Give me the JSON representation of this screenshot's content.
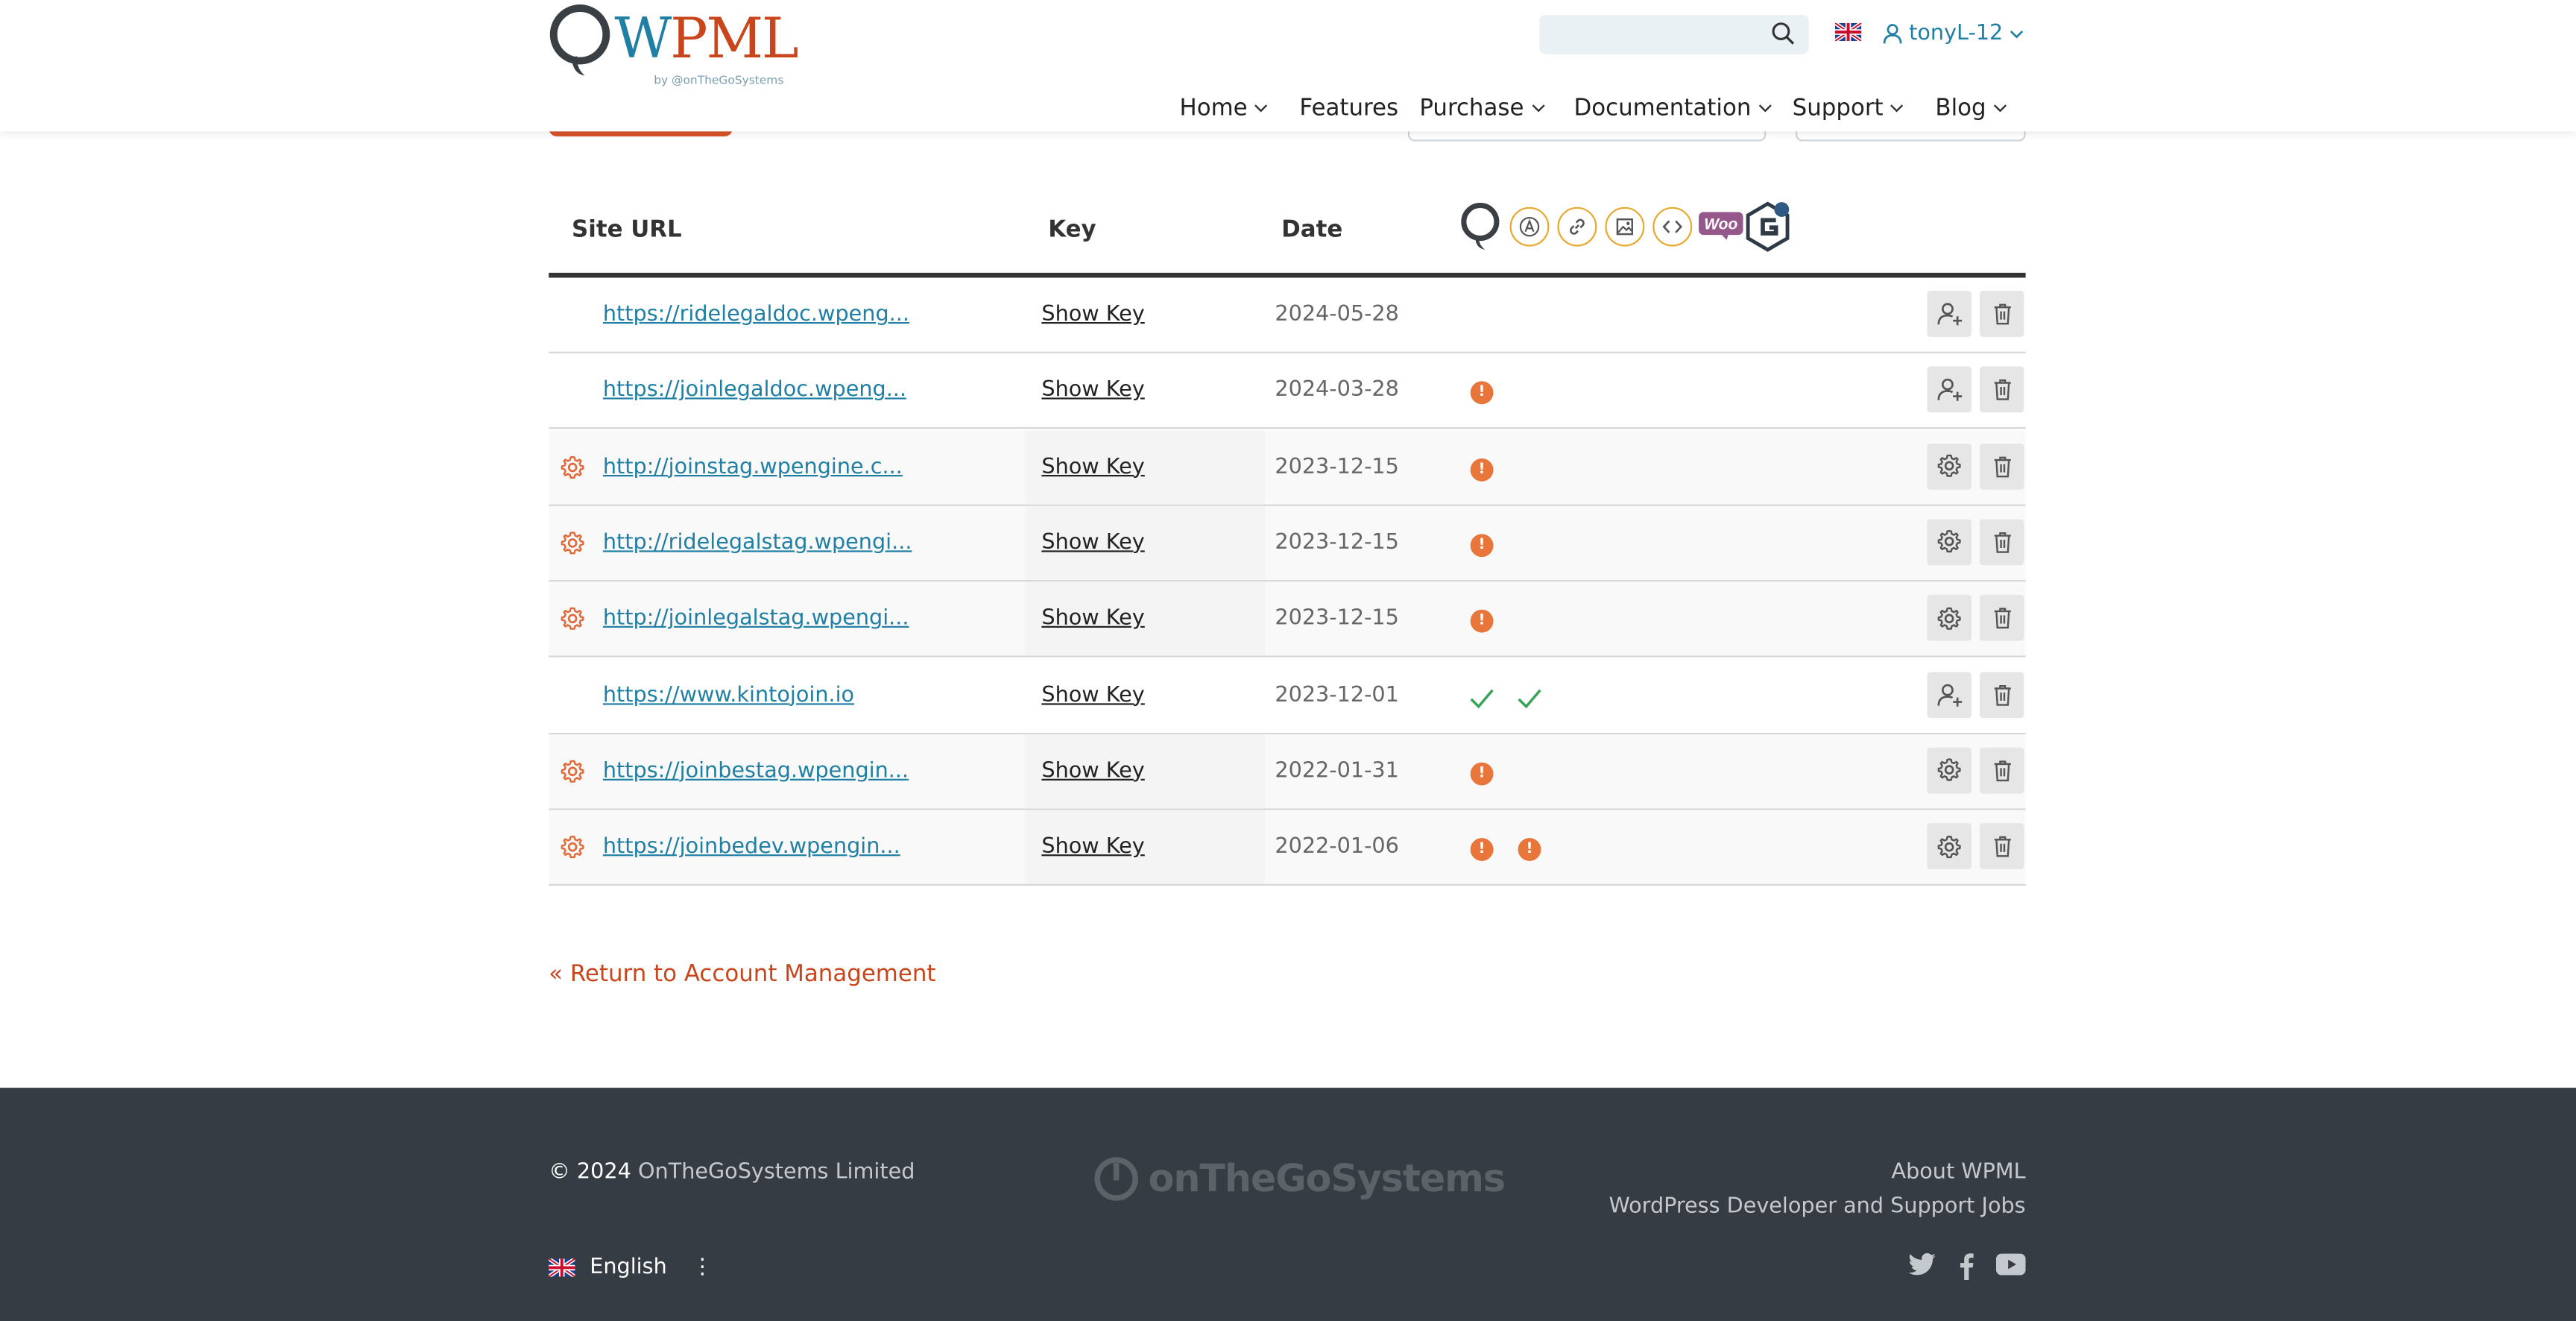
{
  "header": {
    "logo_text_w": "W",
    "logo_text_pml": "PML",
    "logo_by": "by @onTheGoSystems",
    "search_placeholder": "",
    "username": "tonyL-12"
  },
  "nav": [
    {
      "label": "Home",
      "dropdown": true
    },
    {
      "label": "Features",
      "dropdown": false
    },
    {
      "label": "Purchase",
      "dropdown": true
    },
    {
      "label": "Documentation",
      "dropdown": true
    },
    {
      "label": "Support",
      "dropdown": true
    },
    {
      "label": "Blog",
      "dropdown": true
    }
  ],
  "table": {
    "headers": {
      "site_url": "Site URL",
      "key": "Key",
      "date": "Date"
    },
    "plugin_icons": [
      "wpml-logo-icon",
      "string-translation-icon",
      "link-icon",
      "media-icon",
      "code-icon",
      "woocommerce-icon",
      "gravity-forms-icon"
    ],
    "woo_label": "Woo",
    "rows": [
      {
        "url": "https://ridelegaldoc.wpeng...",
        "key_label": "Show Key",
        "date": "2024-05-28",
        "gear": false,
        "status": [],
        "action": "add-user"
      },
      {
        "url": "https://joinlegaldoc.wpeng...",
        "key_label": "Show Key",
        "date": "2024-03-28",
        "gear": false,
        "status": [
          "warn"
        ],
        "action": "add-user"
      },
      {
        "url": "http://joinstag.wpengine.c...",
        "key_label": "Show Key",
        "date": "2023-12-15",
        "gear": true,
        "status": [
          "warn"
        ],
        "action": "settings"
      },
      {
        "url": "http://ridelegalstag.wpengi...",
        "key_label": "Show Key",
        "date": "2023-12-15",
        "gear": true,
        "status": [
          "warn"
        ],
        "action": "settings"
      },
      {
        "url": "http://joinlegalstag.wpengi...",
        "key_label": "Show Key",
        "date": "2023-12-15",
        "gear": true,
        "status": [
          "warn"
        ],
        "action": "settings"
      },
      {
        "url": "https://www.kintojoin.io",
        "key_label": "Show Key",
        "date": "2023-12-01",
        "gear": false,
        "status": [
          "check",
          "check"
        ],
        "action": "add-user"
      },
      {
        "url": "https://joinbestag.wpengin...",
        "key_label": "Show Key",
        "date": "2022-01-31",
        "gear": true,
        "status": [
          "warn"
        ],
        "action": "settings"
      },
      {
        "url": "https://joinbedev.wpengin...",
        "key_label": "Show Key",
        "date": "2022-01-06",
        "gear": true,
        "status": [
          "warn",
          "warn"
        ],
        "action": "settings"
      }
    ],
    "warn_glyph": "!"
  },
  "return_link": "« Return to Account Management",
  "footer": {
    "copy_prefix": "© 2024",
    "company": "OnTheGoSystems Limited",
    "brand": "onTheGoSystems",
    "about": "About WPML",
    "jobs": "WordPress Developer and Support Jobs",
    "language": "English",
    "more_glyph": "⋮"
  },
  "colors": {
    "accent_blue": "#1f7fa4",
    "accent_orange": "#c9461d",
    "warning": "#e8753a",
    "success": "#3aa35b",
    "footer_bg": "#353c43"
  }
}
